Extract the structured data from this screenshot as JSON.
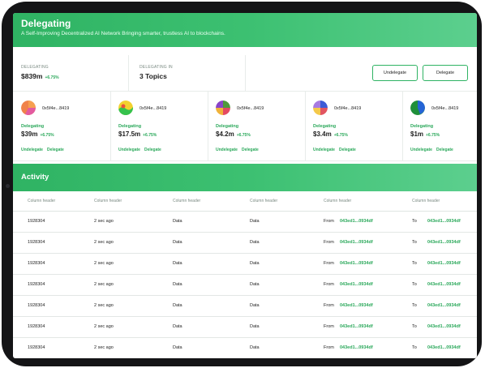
{
  "header": {
    "title": "Delegating",
    "subtitle": "A Self-Improving Decentralized AI Network Bringing smarter, trustless AI  to blockchains."
  },
  "summary": {
    "delegating_label": "DELEGATING",
    "delegating_value": "$839m",
    "delegating_change": "+6.75%",
    "delegating_in_label": "DELEGATING IN",
    "delegating_in_value": "3 Topics",
    "undelegate_label": "Undelegate",
    "delegate_label": "Delegate"
  },
  "cards": [
    {
      "address": "0x5f4e...8419",
      "label": "Delegating",
      "value": "$39m",
      "change": "+6.75%",
      "undelegate": "Undelegate",
      "delegate": "Delegate",
      "avatar_colors": [
        "#f0824a",
        "#e35aa0",
        "#f6a050"
      ]
    },
    {
      "address": "0x5f4e...8419",
      "label": "Delegating",
      "value": "$17.5m",
      "change": "+6.75%",
      "undelegate": "Undelegate",
      "delegate": "Delegate",
      "avatar_colors": [
        "#f2d12f",
        "#36c24d",
        "#e8503e"
      ]
    },
    {
      "address": "0x5f4e...8419",
      "label": "Delegating",
      "value": "$4.2m",
      "change": "+6.75%",
      "undelegate": "Undelegate",
      "delegate": "Delegate",
      "avatar_colors": [
        "#8a44c8",
        "#4f9a3a",
        "#e44a62",
        "#f0b23a"
      ]
    },
    {
      "address": "0x5f4e...8419",
      "label": "Delegating",
      "value": "$3.4m",
      "change": "+6.75%",
      "undelegate": "Undelegate",
      "delegate": "Delegate",
      "avatar_colors": [
        "#a77ae0",
        "#3c5bd6",
        "#e25561",
        "#f4c94a"
      ]
    },
    {
      "address": "0x5f4e...8419",
      "label": "Delegating",
      "value": "$1m",
      "change": "+6.75%",
      "undelegate": "Undelegate",
      "delegate": "Delegate",
      "avatar_colors": [
        "#1f8f3a",
        "#2564d6"
      ]
    }
  ],
  "activity": {
    "title": "Activity",
    "headers": [
      "Column header",
      "Column header",
      "Column header",
      "Column header",
      "Column header",
      "Column header"
    ],
    "rows": [
      {
        "id": "1928304",
        "time": "2 sec ago",
        "data1": "Data",
        "data2": "Data",
        "from_label": "From",
        "from_addr": "043ed1...0934df",
        "to_label": "To",
        "to_addr": "043ed1...0934df"
      },
      {
        "id": "1928304",
        "time": "2 sec ago",
        "data1": "Data",
        "data2": "Data",
        "from_label": "From",
        "from_addr": "043ed1...0934df",
        "to_label": "To",
        "to_addr": "043ed1...0934df"
      },
      {
        "id": "1928304",
        "time": "2 sec ago",
        "data1": "Data",
        "data2": "Data",
        "from_label": "From",
        "from_addr": "043ed1...0934df",
        "to_label": "To",
        "to_addr": "043ed1...0934df"
      },
      {
        "id": "1928304",
        "time": "2 sec ago",
        "data1": "Data",
        "data2": "Data",
        "from_label": "From",
        "from_addr": "043ed1...0934df",
        "to_label": "To",
        "to_addr": "043ed1...0934df"
      },
      {
        "id": "1928304",
        "time": "2 sec ago",
        "data1": "Data",
        "data2": "Data",
        "from_label": "From",
        "from_addr": "043ed1...0934df",
        "to_label": "To",
        "to_addr": "043ed1...0934df"
      },
      {
        "id": "1928304",
        "time": "2 sec ago",
        "data1": "Data",
        "data2": "Data",
        "from_label": "From",
        "from_addr": "043ed1...0934df",
        "to_label": "To",
        "to_addr": "043ed1...0934df"
      },
      {
        "id": "1928304",
        "time": "2 sec ago",
        "data1": "Data",
        "data2": "Data",
        "from_label": "From",
        "from_addr": "043ed1...0934df",
        "to_label": "To",
        "to_addr": "043ed1...0934df"
      }
    ]
  },
  "colors": {
    "accent": "#2fb363",
    "link": "#2aa85a"
  }
}
